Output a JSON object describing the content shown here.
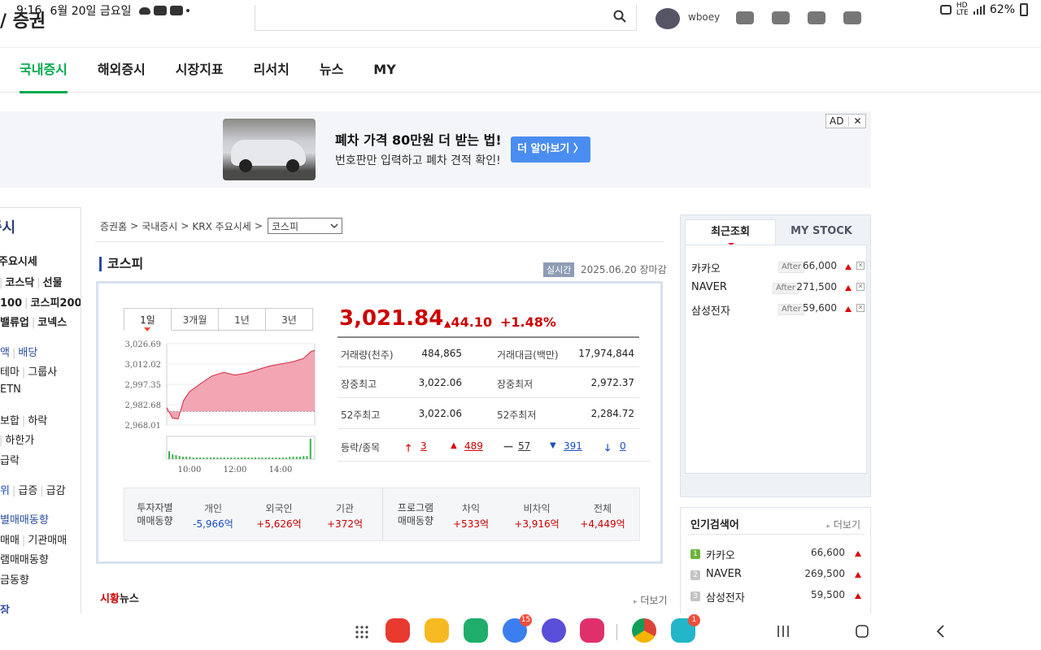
{
  "status_bar": {
    "time": "9:16",
    "date": "6월 20일 금요일",
    "battery": "62%"
  },
  "header": {
    "logo_fragment": "/ 증권",
    "user_id": "wboey"
  },
  "nav": {
    "tabs": [
      "국내증시",
      "해외증시",
      "시장지표",
      "리서치",
      "뉴스",
      "MY"
    ],
    "active_index": 0
  },
  "ad": {
    "title": "폐차 가격 80만원 더 받는 법!",
    "subtitle": "번호판만 입력하고 폐차 견적 확인!",
    "button": "더 알아보기 〉",
    "mark": "AD",
    "close": "✕"
  },
  "sidebar": {
    "title": "증시",
    "items": [
      "주요시세",
      "코스닥",
      "선물",
      "100",
      "코스피200",
      "밸류업",
      "코넥스",
      "액",
      "배당",
      "테마",
      "그룹사",
      "ETN",
      "보합",
      "하락",
      "하한가",
      "급락",
      "위",
      "급증",
      "급감",
      "별매매동향",
      "매매",
      "기관매매",
      "램매매동향",
      "금동향",
      "장"
    ]
  },
  "breadcrumb": {
    "items": [
      "증권홈",
      "국내증시",
      "KRX 주요시세"
    ],
    "select_value": "코스피"
  },
  "index": {
    "name": "코스피",
    "realtime_label": "실시간",
    "date_status": "2025.06.20 장마감",
    "price": "3,021.84",
    "change": "44.10",
    "change_pct": "+1.48%",
    "period_tabs": [
      "1일",
      "3개월",
      "1년",
      "3년"
    ],
    "stats": [
      {
        "k1": "거래량(천주)",
        "v1": "484,865",
        "k2": "거래대금(백만)",
        "v2": "17,974,844"
      },
      {
        "k1": "장중최고",
        "v1": "3,022.06",
        "k2": "장중최저",
        "v2": "2,972.37"
      },
      {
        "k1": "52주최고",
        "v1": "3,022.06",
        "k2": "52주최저",
        "v2": "2,284.72"
      }
    ],
    "updown": {
      "label": "등락/종목",
      "upper_limit": "3",
      "up": "489",
      "flat": "57",
      "down": "391",
      "lower_limit": "0"
    },
    "investor": {
      "label": "투자자별\n매매동향",
      "cols": [
        {
          "h": "개인",
          "v": "-5,966억"
        },
        {
          "h": "외국인",
          "v": "+5,626억"
        },
        {
          "h": "기관",
          "v": "+372억"
        }
      ],
      "program_label": "프로그램\n매매동향",
      "program_cols": [
        {
          "h": "차익",
          "v": "+533억"
        },
        {
          "h": "비차익",
          "v": "+3,916억"
        },
        {
          "h": "전체",
          "v": "+4,449억"
        }
      ]
    }
  },
  "chart_data": {
    "type": "area",
    "title": "",
    "y_ticks": [
      "3,026.69",
      "3,012.02",
      "2,997.35",
      "2,982.68",
      "2,968.01"
    ],
    "x_ticks": [
      "10:00",
      "12:00",
      "14:00"
    ],
    "ylim": [
      2968.01,
      3026.69
    ],
    "reference": 2977.74,
    "x": [
      "09:00",
      "09:15",
      "09:30",
      "09:45",
      "10:00",
      "10:30",
      "11:00",
      "11:30",
      "12:00",
      "12:30",
      "13:00",
      "13:30",
      "14:00",
      "14:30",
      "15:00",
      "15:20",
      "15:30"
    ],
    "values": [
      2980.5,
      2973.0,
      2972.4,
      2986.0,
      2992.0,
      2998.0,
      3003.5,
      3006.0,
      3004.0,
      3005.5,
      3008.0,
      3010.5,
      3012.0,
      3013.5,
      3016.0,
      3021.0,
      3021.84
    ]
  },
  "news": {
    "title_highlight": "시황",
    "title_rest": "뉴스",
    "more": "더보기"
  },
  "recent": {
    "tabs": [
      "최근조회",
      "MY STOCK"
    ],
    "items": [
      {
        "name": "카카오",
        "tag": "After",
        "price": "66,000"
      },
      {
        "name": "NAVER",
        "tag": "After",
        "price": "271,500"
      },
      {
        "name": "삼성전자",
        "tag": "After",
        "price": "59,600"
      }
    ]
  },
  "popular": {
    "title": "인기검색어",
    "more": "더보기",
    "items": [
      {
        "rank": "1",
        "name": "카카오",
        "price": "66,600"
      },
      {
        "rank": "2",
        "name": "NAVER",
        "price": "269,500"
      },
      {
        "rank": "3",
        "name": "삼성전자",
        "price": "59,500"
      }
    ]
  },
  "bottom_bar": {
    "messages_badge": "15",
    "lock_badge": "1"
  },
  "colors": {
    "accent_green": "#03a94f",
    "up_red": "#cc0000",
    "down_blue": "#1a4ec3",
    "chart_fill": "#f2a6b3"
  }
}
